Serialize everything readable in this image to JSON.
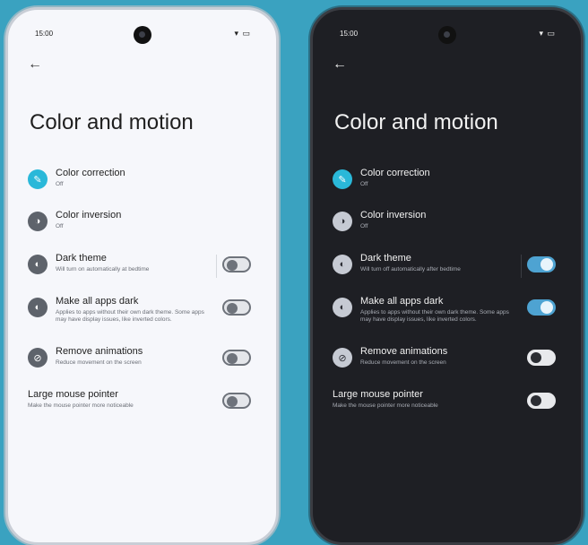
{
  "light": {
    "time": "15:00",
    "title": "Color and motion",
    "items": [
      {
        "label": "Color correction",
        "sub": "Off"
      },
      {
        "label": "Color inversion",
        "sub": "Off"
      },
      {
        "label": "Dark theme",
        "sub": "Will turn on automatically at bedtime",
        "toggle": "off"
      },
      {
        "label": "Make all apps dark",
        "sub": "Applies to apps without their own dark theme. Some apps may have display issues, like inverted colors.",
        "toggle": "off"
      },
      {
        "label": "Remove animations",
        "sub": "Reduce movement on the screen",
        "toggle": "off"
      },
      {
        "label": "Large mouse pointer",
        "sub": "Make the mouse pointer more noticeable",
        "toggle": "off"
      }
    ]
  },
  "dark": {
    "time": "15:00",
    "title": "Color and motion",
    "items": [
      {
        "label": "Color correction",
        "sub": "Off"
      },
      {
        "label": "Color inversion",
        "sub": "Off"
      },
      {
        "label": "Dark theme",
        "sub": "Will turn off automatically after bedtime",
        "toggle": "on"
      },
      {
        "label": "Make all apps dark",
        "sub": "Applies to apps without their own dark theme. Some apps may have display issues, like inverted colors.",
        "toggle": "on"
      },
      {
        "label": "Remove animations",
        "sub": "Reduce movement on the screen",
        "toggle": "off"
      },
      {
        "label": "Large mouse pointer",
        "sub": "Make the mouse pointer more noticeable",
        "toggle": "off"
      }
    ]
  },
  "icons": [
    "color-correction-icon",
    "color-inversion-icon",
    "dark-theme-icon",
    "make-apps-dark-icon",
    "remove-animations-icon"
  ],
  "colors": {
    "background": "#3aa2c0",
    "accent": "#2ab8d9",
    "toggle_on": "#4ea3d2"
  }
}
